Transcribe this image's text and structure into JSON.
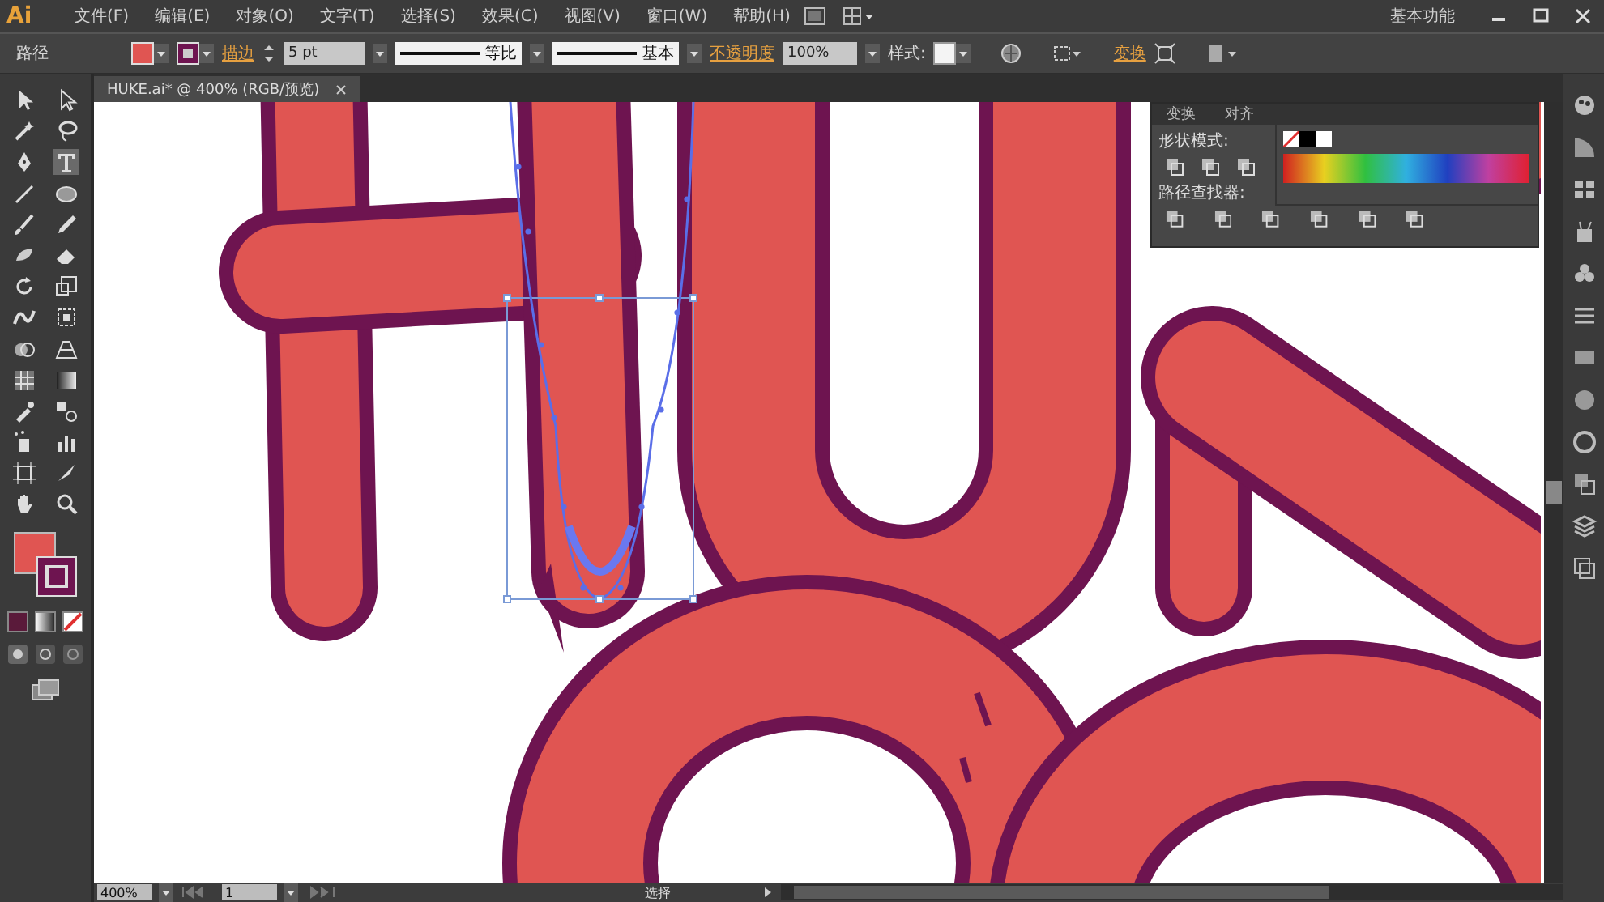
{
  "app": {
    "logo": "Ai",
    "menus": [
      "文件(F)",
      "编辑(E)",
      "对象(O)",
      "文字(T)",
      "选择(S)",
      "效果(C)",
      "视图(V)",
      "窗口(W)",
      "帮助(H)"
    ],
    "workspace": "基本功能"
  },
  "control_bar": {
    "selection": "路径",
    "stroke_label": "描边",
    "stroke_weight": "5 pt",
    "profile": "等比",
    "brush": "基本",
    "opacity_label": "不透明度",
    "opacity": "100%",
    "style_label": "样式:",
    "transform": "变换"
  },
  "document_tab": {
    "title": "HUKE.ai* @ 400% (RGB/预览)"
  },
  "panel": {
    "tabs": [
      "变换",
      "对齐"
    ],
    "sections": [
      {
        "title": "形状模式:"
      },
      {
        "title": "路径查找器:"
      }
    ]
  },
  "status_bar": {
    "zoom": "400%",
    "page": "1",
    "tool": "选择"
  }
}
